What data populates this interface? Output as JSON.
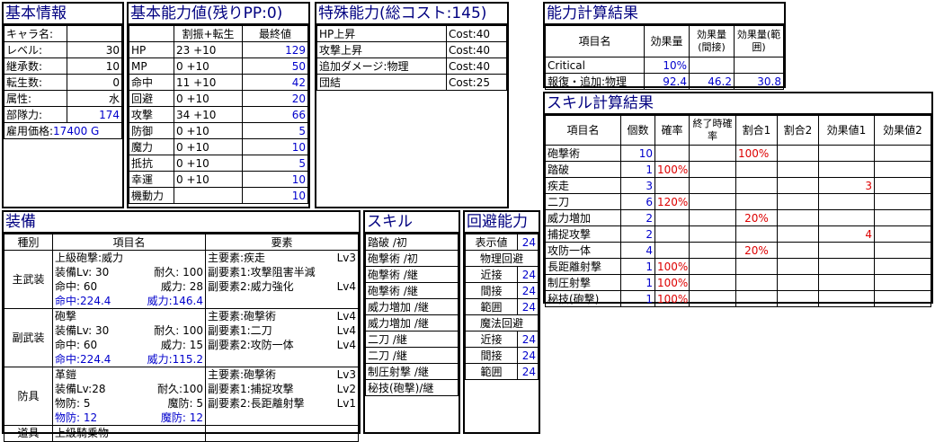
{
  "basic_info": {
    "title": "基本情報",
    "rows": [
      {
        "label": "キャラ名:",
        "value": ""
      },
      {
        "label": "レベル:",
        "value": "30"
      },
      {
        "label": "継承数:",
        "value": "10"
      },
      {
        "label": "転生数:",
        "value": "0"
      },
      {
        "label": "属性:",
        "value": "水"
      },
      {
        "label": "部隊力:",
        "value": "174"
      },
      {
        "label": "雇用価格:",
        "value": "17400 G"
      }
    ]
  },
  "abilities": {
    "title": "基本能力値(残りPP:0)",
    "col_alloc": "割振+転生",
    "col_final": "最終値",
    "rows": [
      {
        "name": "HP",
        "alloc": "23 +10",
        "final": "129"
      },
      {
        "name": "MP",
        "alloc": "0 +10",
        "final": "50"
      },
      {
        "name": "命中",
        "alloc": "11 +10",
        "final": "42"
      },
      {
        "name": "回避",
        "alloc": "0 +10",
        "final": "20"
      },
      {
        "name": "攻撃",
        "alloc": "34 +10",
        "final": "66"
      },
      {
        "name": "防御",
        "alloc": "0 +10",
        "final": "5"
      },
      {
        "name": "魔力",
        "alloc": "0 +10",
        "final": "10"
      },
      {
        "name": "抵抗",
        "alloc": "0 +10",
        "final": "5"
      },
      {
        "name": "幸運",
        "alloc": "0 +10",
        "final": "10"
      },
      {
        "name": "機動力",
        "alloc": "",
        "final": "10"
      }
    ]
  },
  "special": {
    "title": "特殊能力(総コスト:145)",
    "rows": [
      {
        "name": "HP上昇",
        "cost": "Cost:40"
      },
      {
        "name": "攻撃上昇",
        "cost": "Cost:40"
      },
      {
        "name": "追加ダメージ:物理",
        "cost": "Cost:40"
      },
      {
        "name": "団結",
        "cost": "Cost:25"
      }
    ]
  },
  "ability_calc": {
    "title": "能力計算結果",
    "h_item": "項目名",
    "h_eff": "効果量",
    "h_eff_indirect": "効果量(間接)",
    "h_eff_range": "効果量(範囲)",
    "rows": [
      {
        "name": "Critical",
        "eff": "10%",
        "ind": "",
        "rng": ""
      },
      {
        "name": "報復・追加:物理",
        "eff": "92.4",
        "ind": "46.2",
        "rng": "30.8"
      }
    ]
  },
  "skill_calc": {
    "title": "スキル計算結果",
    "headers": [
      "項目名",
      "個数",
      "確率",
      "終了時確率",
      "割合1",
      "割合2",
      "効果値1",
      "効果値2"
    ],
    "rows": [
      {
        "name": "砲撃術",
        "count": "10",
        "prob": "",
        "end": "",
        "r1": "100%",
        "r2": "",
        "e1": "",
        "e2": ""
      },
      {
        "name": "踏破",
        "count": "1",
        "prob": "100%",
        "end": "",
        "r1": "",
        "r2": "",
        "e1": "",
        "e2": ""
      },
      {
        "name": "疾走",
        "count": "3",
        "prob": "",
        "end": "",
        "r1": "",
        "r2": "",
        "e1": "3",
        "e2": ""
      },
      {
        "name": "二刀",
        "count": "6",
        "prob": "120%",
        "end": "",
        "r1": "",
        "r2": "",
        "e1": "",
        "e2": ""
      },
      {
        "name": "威力増加",
        "count": "2",
        "prob": "",
        "end": "",
        "r1": "20%",
        "r2": "",
        "e1": "",
        "e2": ""
      },
      {
        "name": "捕捉攻撃",
        "count": "2",
        "prob": "",
        "end": "",
        "r1": "",
        "r2": "",
        "e1": "4",
        "e2": ""
      },
      {
        "name": "攻防一体",
        "count": "4",
        "prob": "",
        "end": "",
        "r1": "20%",
        "r2": "",
        "e1": "",
        "e2": ""
      },
      {
        "name": "長距離射撃",
        "count": "1",
        "prob": "100%",
        "end": "",
        "r1": "",
        "r2": "",
        "e1": "",
        "e2": ""
      },
      {
        "name": "制圧射撃",
        "count": "1",
        "prob": "100%",
        "end": "",
        "r1": "",
        "r2": "",
        "e1": "",
        "e2": ""
      },
      {
        "name": "秘技(砲撃)",
        "count": "1",
        "prob": "100%",
        "end": "",
        "r1": "",
        "r2": "",
        "e1": "",
        "e2": ""
      }
    ]
  },
  "equipment": {
    "title": "装備",
    "h_type": "種別",
    "h_item": "項目名",
    "h_elem": "要素",
    "main": {
      "type": "主武装",
      "name": "上級砲撃:威力",
      "lv_label": "装備Lv:",
      "lv": "30",
      "dur_label": "耐久:",
      "dur": "100",
      "hit_label": "命中:",
      "hit": "60",
      "pow_label": "威力:",
      "pow": "28",
      "hit_total": "命中:224.4",
      "pow_total": "威力:146.4",
      "e_main": "主要素:疾走",
      "e_main_lv": "Lv3",
      "e_sub1": "副要素1:攻撃阻害半減",
      "e_sub1_lv": "",
      "e_sub2": "副要素2:威力強化",
      "e_sub2_lv": "Lv4"
    },
    "sub": {
      "type": "副武装",
      "name": "砲撃",
      "lv_label": "装備Lv:",
      "lv": "30",
      "dur_label": "耐久:",
      "dur": "100",
      "hit_label": "命中:",
      "hit": "60",
      "pow_label": "威力:",
      "pow": "15",
      "hit_total": "命中:224.4",
      "pow_total": "威力:115.2",
      "e_main": "主要素:砲撃術",
      "e_main_lv": "Lv4",
      "e_sub1": "副要素1:二刀",
      "e_sub1_lv": "Lv4",
      "e_sub2": "副要素2:攻防一体",
      "e_sub2_lv": "Lv4"
    },
    "armor": {
      "type": "防具",
      "name": "革鎧",
      "lv_label": "装備Lv:",
      "lv": "28",
      "dur_label": "耐久:",
      "dur": "100",
      "def_label": "物防:",
      "def": "5",
      "mdef_label": "魔防:",
      "mdef": "5",
      "def_total_label": "物防:",
      "def_total": "12",
      "mdef_total_label": "魔防:",
      "mdef_total": "12",
      "e_main": "主要素:砲撃術",
      "e_main_lv": "Lv3",
      "e_sub1": "副要素1:捕捉攻撃",
      "e_sub1_lv": "Lv2",
      "e_sub2": "副要素2:長距離射撃",
      "e_sub2_lv": "Lv1"
    },
    "tool": {
      "type": "道具",
      "name": "上級騎乗物"
    }
  },
  "skills": {
    "title": "スキル",
    "items": [
      "踏破 /初",
      "砲撃術 /初",
      "砲撃術 /継",
      "砲撃術 /継",
      "威力増加 /継",
      "威力増加 /継",
      "二刀 /継",
      "二刀 /継",
      "制圧射撃 /継",
      "秘技(砲撃)/継"
    ]
  },
  "evasion": {
    "title": "回避能力",
    "display_label": "表示値",
    "display_value": "24",
    "phys_label": "物理回避",
    "phys": [
      {
        "label": "近接",
        "value": "24"
      },
      {
        "label": "間接",
        "value": "24"
      },
      {
        "label": "範囲",
        "value": "24"
      }
    ],
    "magic_label": "魔法回避",
    "magic": [
      {
        "label": "近接",
        "value": "24"
      },
      {
        "label": "間接",
        "value": "24"
      },
      {
        "label": "範囲",
        "value": "24"
      }
    ]
  },
  "colors": {
    "title_blue": "#000080",
    "value_blue": "#0000cc",
    "value_red": "#dd0000"
  }
}
